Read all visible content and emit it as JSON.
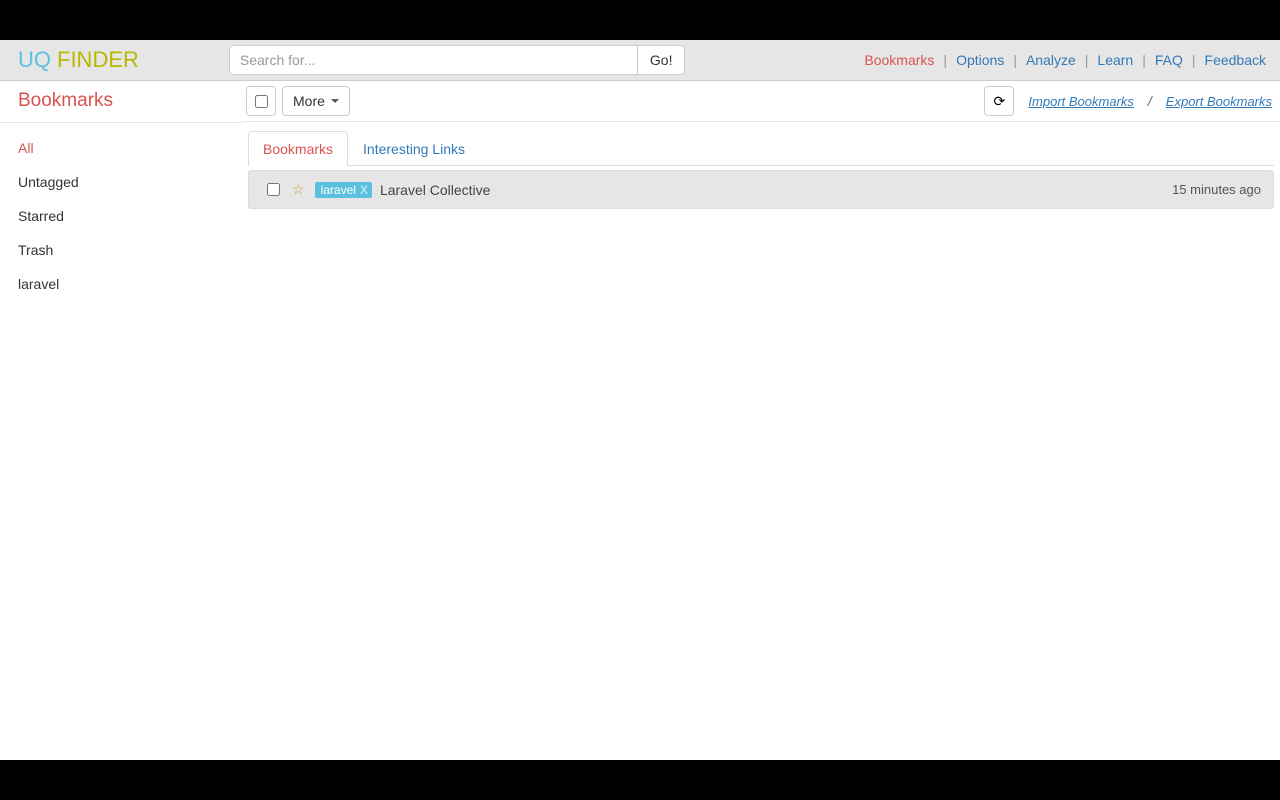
{
  "brand": {
    "uq": "UQ",
    "finder": "FINDER"
  },
  "search": {
    "placeholder": "Search for...",
    "go": "Go!"
  },
  "topnav": {
    "bookmarks": "Bookmarks",
    "options": "Options",
    "analyze": "Analyze",
    "learn": "Learn",
    "faq": "FAQ",
    "feedback": "Feedback"
  },
  "sidebar": {
    "title": "Bookmarks",
    "items": [
      {
        "label": "All",
        "active": true
      },
      {
        "label": "Untagged",
        "active": false
      },
      {
        "label": "Starred",
        "active": false
      },
      {
        "label": "Trash",
        "active": false
      },
      {
        "label": "laravel",
        "active": false
      }
    ]
  },
  "toolbar": {
    "more": "More",
    "import": "Import Bookmarks",
    "export": "Export Bookmarks"
  },
  "tabs": {
    "bookmarks": "Bookmarks",
    "interesting": "Interesting Links"
  },
  "rows": [
    {
      "tag": "laravel",
      "title": "Laravel Collective",
      "time": "15 minutes ago"
    }
  ]
}
